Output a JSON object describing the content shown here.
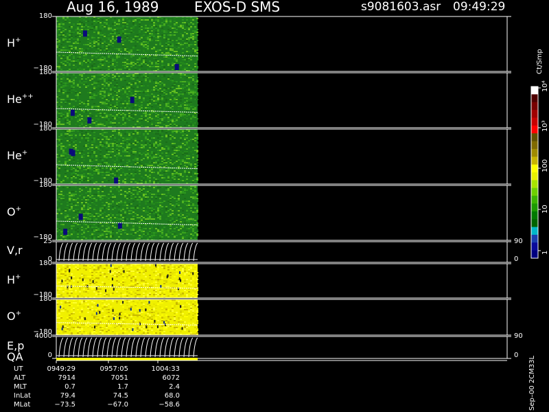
{
  "header": {
    "date": "Aug 16, 1989",
    "mission": "EXOS-D SMS",
    "file": "s9081603.asr",
    "time": "09:49:29"
  },
  "panels": [
    {
      "base": "H",
      "sup": "+",
      "tick_top": "180",
      "tick_bottom": "−180",
      "kind": "angle-spectrogram",
      "palette": "green"
    },
    {
      "base": "He",
      "sup": "++",
      "tick_top": "180",
      "tick_bottom": "−180",
      "kind": "angle-spectrogram",
      "palette": "green"
    },
    {
      "base": "He",
      "sup": "+",
      "tick_top": "180",
      "tick_bottom": "−180",
      "kind": "angle-spectrogram",
      "palette": "green"
    },
    {
      "base": "O",
      "sup": "+",
      "tick_top": "180",
      "tick_bottom": "−180",
      "kind": "angle-spectrogram",
      "palette": "green"
    },
    {
      "base": "V,r",
      "sup": "",
      "tick_top": "25",
      "tick_bottom": "0",
      "right_top": "90",
      "right_bottom": "0",
      "kind": "line-panel"
    },
    {
      "base": "H",
      "sup": "+",
      "tick_top": "180",
      "tick_bottom": "−180",
      "kind": "angle-spectrogram",
      "palette": "yellow"
    },
    {
      "base": "O",
      "sup": "+",
      "tick_top": "180",
      "tick_bottom": "−180",
      "kind": "angle-spectrogram",
      "palette": "yellow"
    },
    {
      "base": "E,p",
      "sup": "",
      "tick_top": "4000",
      "tick_bottom": "0",
      "right_top": "90",
      "right_bottom": "0",
      "kind": "line-panel"
    }
  ],
  "qa_label": "QA",
  "colorbar": {
    "unit": "Ct/Smp",
    "labels": [
      "1",
      "10",
      "100",
      "10³",
      "10⁴"
    ],
    "colors": [
      "#000080",
      "#0a0a9a",
      "#1a3fb0",
      "#00b8c8",
      "#006400",
      "#007a00",
      "#1c9a00",
      "#3cb400",
      "#6ed000",
      "#a8e400",
      "#e8f000",
      "#ffff00",
      "#c8b400",
      "#a08a00",
      "#806a00",
      "#605000",
      "#ff0000",
      "#c80000",
      "#a00000",
      "#780000",
      "#500000",
      "#ffffff"
    ]
  },
  "footer_axis": {
    "rows": [
      {
        "label": "UT",
        "values": [
          "0949:29",
          "0957:05",
          "1004:33"
        ]
      },
      {
        "label": "ALT",
        "values": [
          "7914",
          "7051",
          "6072"
        ]
      },
      {
        "label": "MLT",
        "values": [
          "0.7",
          "1.7",
          "2.4"
        ]
      },
      {
        "label": "InLat",
        "values": [
          "79.4",
          "74.5",
          "68.0"
        ]
      },
      {
        "label": "MLat",
        "values": [
          "−73.5",
          "−67.0",
          "−58.6"
        ]
      }
    ]
  },
  "footer_note": "Sep–00 2CM33L",
  "chart_data": {
    "type": "heatmap",
    "title": "Aug 16, 1989   EXOS-D SMS",
    "x": {
      "quantity": "UT",
      "ticks": [
        "0949:29",
        "0957:05",
        "1004:33"
      ]
    },
    "y_range_angle": [
      -180,
      180
    ],
    "color_scale": {
      "unit": "Ct/Smp",
      "log": true,
      "range": [
        1,
        10000
      ]
    },
    "series": [
      {
        "name": "H+",
        "dominant_level_ct": 30
      },
      {
        "name": "He++",
        "dominant_level_ct": 25
      },
      {
        "name": "He+",
        "dominant_level_ct": 20
      },
      {
        "name": "O+",
        "dominant_level_ct": 20
      },
      {
        "name": "V,r",
        "y_range": [
          0,
          25
        ],
        "right_range": [
          0,
          90
        ]
      },
      {
        "name": "H+",
        "dominant_level_ct": 150
      },
      {
        "name": "O+",
        "dominant_level_ct": 120
      },
      {
        "name": "E,p",
        "y_range": [
          0,
          4000
        ],
        "right_range": [
          0,
          90
        ]
      }
    ]
  }
}
